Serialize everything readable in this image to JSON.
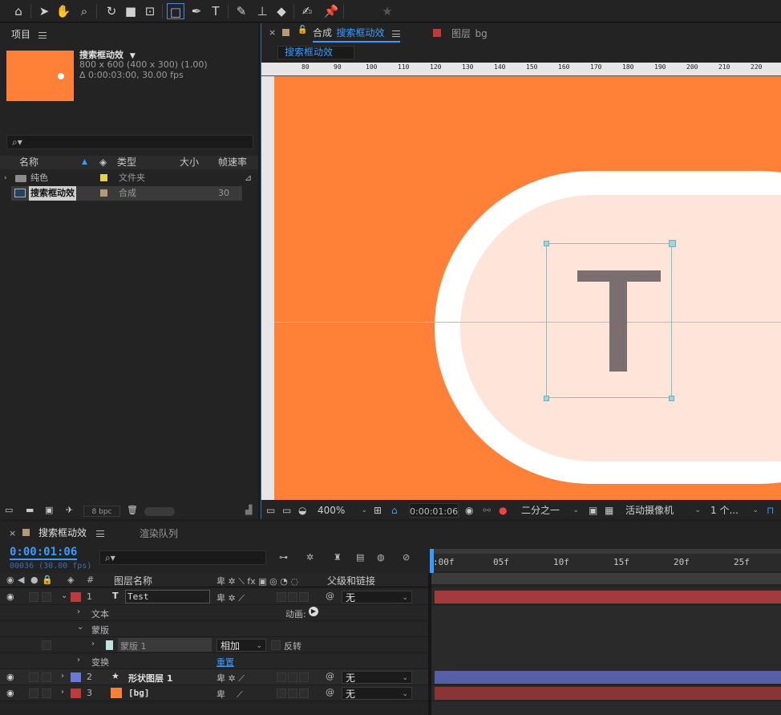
{
  "toolbar": {
    "tools": [
      {
        "icon": "home-icon",
        "glyph": "⌂"
      },
      {
        "icon": "selection-arrow-icon",
        "glyph": "➤"
      },
      {
        "icon": "hand-icon",
        "glyph": "✋"
      },
      {
        "icon": "zoom-icon",
        "glyph": "⌕"
      },
      {
        "icon": "rotate-icon",
        "glyph": "↻"
      },
      {
        "icon": "camera-icon",
        "glyph": "■"
      },
      {
        "icon": "pan-behind-icon",
        "glyph": "⊡"
      },
      {
        "icon": "rectangle-tool-icon",
        "glyph": "□"
      },
      {
        "icon": "pen-icon",
        "glyph": "✒"
      },
      {
        "icon": "type-tool-icon",
        "glyph": "T"
      },
      {
        "icon": "brush-icon",
        "glyph": "✎"
      },
      {
        "icon": "clone-stamp-icon",
        "glyph": "⊥"
      },
      {
        "icon": "eraser-icon",
        "glyph": "◆"
      },
      {
        "icon": "roto-brush-icon",
        "glyph": "✍"
      },
      {
        "icon": "puppet-pin-icon",
        "glyph": "📌"
      },
      {
        "icon": "star-icon",
        "glyph": "★"
      }
    ]
  },
  "project": {
    "title": "项目",
    "comp_name": "搜索框动效",
    "comp_size": "800 x 600  (400 x 300) (1.00)",
    "comp_duration": "Δ 0:00:03:00, 30.00 fps",
    "search_placeholder": "",
    "columns": {
      "name": "名称",
      "type": "类型",
      "size": "大小",
      "fps": "帧速率"
    },
    "items": [
      {
        "name": "纯色",
        "type": "文件夹",
        "fps": "",
        "color": "#e6d24a"
      },
      {
        "name": "搜索框动效",
        "type": "合成",
        "fps": "30",
        "color": "#b59a7a"
      }
    ],
    "bpc": "8 bpc"
  },
  "comp": {
    "tab_prefix": "合成",
    "tab_name": "搜索框动效",
    "layer_tab_prefix": "图层",
    "layer_tab_name": "bg",
    "breadcrumb": "搜索框动效",
    "ruler_ticks": [
      "80",
      "90",
      "100",
      "110",
      "120",
      "130",
      "140",
      "150",
      "160",
      "170",
      "180",
      "190",
      "200",
      "210",
      "220"
    ],
    "zoom": "400%",
    "timecode": "0:00:01:06",
    "resolution": "二分之一",
    "camera": "活动摄像机",
    "views": "1 个...",
    "bg_color": "#ff8036"
  },
  "timeline": {
    "tab_name": "搜索框动效",
    "render_tab": "渲染队列",
    "current_time": "0:00:01:06",
    "frame_info": "00036 (30.00 fps)",
    "col_layer_name": "图层名称",
    "col_parent": "父级和链接",
    "ruler": [
      ":00f",
      "05f",
      "10f",
      "15f",
      "20f",
      "25f"
    ],
    "layers": [
      {
        "num": "1",
        "name": "Test",
        "type_glyph": "T",
        "color": "#c0393b",
        "parent": "无"
      },
      {
        "num": "2",
        "name": "形状图层 1",
        "type_glyph": "★",
        "color": "#6a79d8",
        "parent": "无"
      },
      {
        "num": "3",
        "name": "[bg]",
        "type_glyph": "■",
        "color": "#c0393b",
        "parent": "无"
      }
    ],
    "sub": {
      "text": "文本",
      "animate": "动画:",
      "masks": "蒙版",
      "mask_name": "蒙版 1",
      "mask_mode": "相加",
      "invert": "反转",
      "transform": "变换",
      "reset": "重置"
    }
  }
}
